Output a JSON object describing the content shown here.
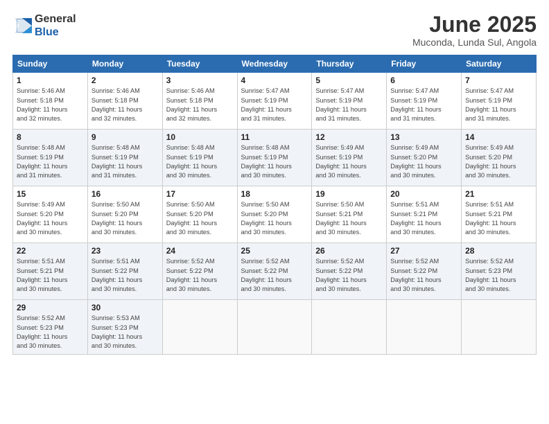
{
  "logo": {
    "line1": "General",
    "line2": "Blue"
  },
  "title": "June 2025",
  "location": "Muconda, Lunda Sul, Angola",
  "headers": [
    "Sunday",
    "Monday",
    "Tuesday",
    "Wednesday",
    "Thursday",
    "Friday",
    "Saturday"
  ],
  "weeks": [
    [
      {
        "day": "1",
        "info": "Sunrise: 5:46 AM\nSunset: 5:18 PM\nDaylight: 11 hours\nand 32 minutes."
      },
      {
        "day": "2",
        "info": "Sunrise: 5:46 AM\nSunset: 5:18 PM\nDaylight: 11 hours\nand 32 minutes."
      },
      {
        "day": "3",
        "info": "Sunrise: 5:46 AM\nSunset: 5:18 PM\nDaylight: 11 hours\nand 32 minutes."
      },
      {
        "day": "4",
        "info": "Sunrise: 5:47 AM\nSunset: 5:19 PM\nDaylight: 11 hours\nand 31 minutes."
      },
      {
        "day": "5",
        "info": "Sunrise: 5:47 AM\nSunset: 5:19 PM\nDaylight: 11 hours\nand 31 minutes."
      },
      {
        "day": "6",
        "info": "Sunrise: 5:47 AM\nSunset: 5:19 PM\nDaylight: 11 hours\nand 31 minutes."
      },
      {
        "day": "7",
        "info": "Sunrise: 5:47 AM\nSunset: 5:19 PM\nDaylight: 11 hours\nand 31 minutes."
      }
    ],
    [
      {
        "day": "8",
        "info": "Sunrise: 5:48 AM\nSunset: 5:19 PM\nDaylight: 11 hours\nand 31 minutes."
      },
      {
        "day": "9",
        "info": "Sunrise: 5:48 AM\nSunset: 5:19 PM\nDaylight: 11 hours\nand 31 minutes."
      },
      {
        "day": "10",
        "info": "Sunrise: 5:48 AM\nSunset: 5:19 PM\nDaylight: 11 hours\nand 30 minutes."
      },
      {
        "day": "11",
        "info": "Sunrise: 5:48 AM\nSunset: 5:19 PM\nDaylight: 11 hours\nand 30 minutes."
      },
      {
        "day": "12",
        "info": "Sunrise: 5:49 AM\nSunset: 5:19 PM\nDaylight: 11 hours\nand 30 minutes."
      },
      {
        "day": "13",
        "info": "Sunrise: 5:49 AM\nSunset: 5:20 PM\nDaylight: 11 hours\nand 30 minutes."
      },
      {
        "day": "14",
        "info": "Sunrise: 5:49 AM\nSunset: 5:20 PM\nDaylight: 11 hours\nand 30 minutes."
      }
    ],
    [
      {
        "day": "15",
        "info": "Sunrise: 5:49 AM\nSunset: 5:20 PM\nDaylight: 11 hours\nand 30 minutes."
      },
      {
        "day": "16",
        "info": "Sunrise: 5:50 AM\nSunset: 5:20 PM\nDaylight: 11 hours\nand 30 minutes."
      },
      {
        "day": "17",
        "info": "Sunrise: 5:50 AM\nSunset: 5:20 PM\nDaylight: 11 hours\nand 30 minutes."
      },
      {
        "day": "18",
        "info": "Sunrise: 5:50 AM\nSunset: 5:20 PM\nDaylight: 11 hours\nand 30 minutes."
      },
      {
        "day": "19",
        "info": "Sunrise: 5:50 AM\nSunset: 5:21 PM\nDaylight: 11 hours\nand 30 minutes."
      },
      {
        "day": "20",
        "info": "Sunrise: 5:51 AM\nSunset: 5:21 PM\nDaylight: 11 hours\nand 30 minutes."
      },
      {
        "day": "21",
        "info": "Sunrise: 5:51 AM\nSunset: 5:21 PM\nDaylight: 11 hours\nand 30 minutes."
      }
    ],
    [
      {
        "day": "22",
        "info": "Sunrise: 5:51 AM\nSunset: 5:21 PM\nDaylight: 11 hours\nand 30 minutes."
      },
      {
        "day": "23",
        "info": "Sunrise: 5:51 AM\nSunset: 5:22 PM\nDaylight: 11 hours\nand 30 minutes."
      },
      {
        "day": "24",
        "info": "Sunrise: 5:52 AM\nSunset: 5:22 PM\nDaylight: 11 hours\nand 30 minutes."
      },
      {
        "day": "25",
        "info": "Sunrise: 5:52 AM\nSunset: 5:22 PM\nDaylight: 11 hours\nand 30 minutes."
      },
      {
        "day": "26",
        "info": "Sunrise: 5:52 AM\nSunset: 5:22 PM\nDaylight: 11 hours\nand 30 minutes."
      },
      {
        "day": "27",
        "info": "Sunrise: 5:52 AM\nSunset: 5:22 PM\nDaylight: 11 hours\nand 30 minutes."
      },
      {
        "day": "28",
        "info": "Sunrise: 5:52 AM\nSunset: 5:23 PM\nDaylight: 11 hours\nand 30 minutes."
      }
    ],
    [
      {
        "day": "29",
        "info": "Sunrise: 5:52 AM\nSunset: 5:23 PM\nDaylight: 11 hours\nand 30 minutes."
      },
      {
        "day": "30",
        "info": "Sunrise: 5:53 AM\nSunset: 5:23 PM\nDaylight: 11 hours\nand 30 minutes."
      },
      {
        "day": "",
        "info": ""
      },
      {
        "day": "",
        "info": ""
      },
      {
        "day": "",
        "info": ""
      },
      {
        "day": "",
        "info": ""
      },
      {
        "day": "",
        "info": ""
      }
    ]
  ]
}
